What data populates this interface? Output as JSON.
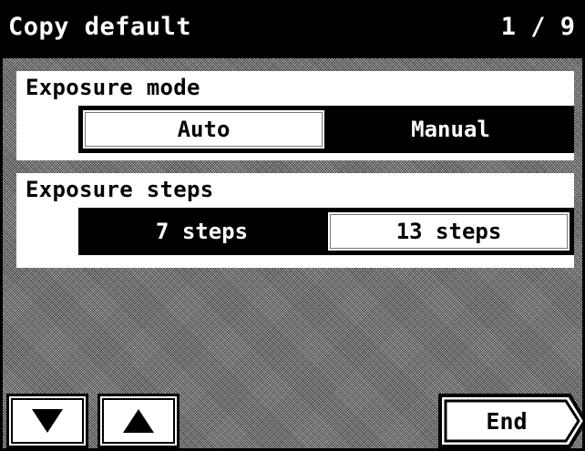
{
  "header": {
    "title": "Copy default",
    "page_indicator": "1 / 9"
  },
  "exposure_mode": {
    "label": "Exposure mode",
    "options": [
      "Auto",
      "Manual"
    ],
    "selected": "Manual"
  },
  "exposure_steps": {
    "label": "Exposure steps",
    "options": [
      "7 steps",
      "13 steps"
    ],
    "selected": "7 steps"
  },
  "footer": {
    "down_icon": "triangle-down",
    "up_icon": "triangle-up",
    "end_label": "End"
  },
  "colors": {
    "foreground": "#000000",
    "background": "#ffffff",
    "pattern": "#7a7a7a"
  }
}
